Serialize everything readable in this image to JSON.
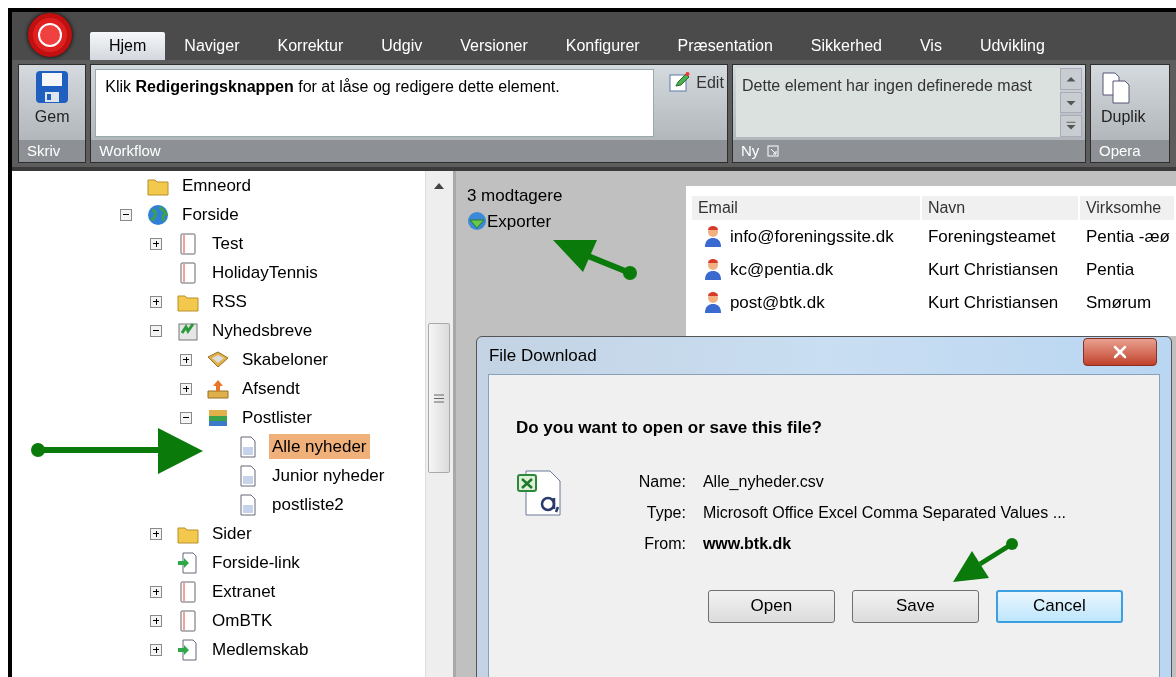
{
  "tabs": [
    {
      "label": "Hjem",
      "selected": true
    },
    {
      "label": "Naviger",
      "selected": false
    },
    {
      "label": "Korrektur",
      "selected": false
    },
    {
      "label": "Udgiv",
      "selected": false
    },
    {
      "label": "Versioner",
      "selected": false
    },
    {
      "label": "Konfigurer",
      "selected": false
    },
    {
      "label": "Præsentation",
      "selected": false
    },
    {
      "label": "Sikkerhed",
      "selected": false
    },
    {
      "label": "Vis",
      "selected": false
    },
    {
      "label": "Udvikling",
      "selected": false
    }
  ],
  "ribbon": {
    "write_group": {
      "label": "Skriv",
      "save_button": "Gem"
    },
    "workflow_group": {
      "label": "Workflow",
      "message": "Klik **Redigeringsknappen** for at låse og redigere dette element.",
      "edit_button": "Edit"
    },
    "new_group": {
      "label": "Ny",
      "text": "Dette element har ingen definerede mast"
    },
    "operations_group": {
      "label": "Opera",
      "duplicate_button": "Duplik"
    }
  },
  "tree": {
    "items": [
      {
        "label": "Emneord",
        "kind": "folder",
        "selected": false
      },
      {
        "label": "Forside",
        "kind": "globe",
        "selected": false,
        "expanded": true,
        "children": [
          {
            "label": "Test",
            "kind": "page",
            "selected": false,
            "expanded": false
          },
          {
            "label": "HolidayTennis",
            "kind": "page",
            "selected": false
          },
          {
            "label": "RSS",
            "kind": "folder",
            "selected": false,
            "expanded": false
          },
          {
            "label": "Nyhedsbreve",
            "kind": "newsletter",
            "selected": false,
            "expanded": true,
            "children": [
              {
                "label": "Skabeloner",
                "kind": "template",
                "selected": false,
                "expanded": false
              },
              {
                "label": "Afsendt",
                "kind": "outbox",
                "selected": false,
                "expanded": false
              },
              {
                "label": "Postlister",
                "kind": "stack",
                "selected": false,
                "expanded": true,
                "children": [
                  {
                    "label": "Alle nyheder",
                    "kind": "list",
                    "selected": true
                  },
                  {
                    "label": "Junior nyheder",
                    "kind": "list",
                    "selected": false
                  },
                  {
                    "label": "postliste2",
                    "kind": "list",
                    "selected": false
                  }
                ]
              }
            ]
          },
          {
            "label": "Sider",
            "kind": "folder",
            "selected": false,
            "expanded": false
          },
          {
            "label": "Forside-link",
            "kind": "link",
            "selected": false
          },
          {
            "label": "Extranet",
            "kind": "page",
            "selected": false,
            "expanded": false
          },
          {
            "label": "OmBTK",
            "kind": "page",
            "selected": false,
            "expanded": false
          },
          {
            "label": "Medlemskab",
            "kind": "link",
            "selected": false,
            "expanded": false
          }
        ]
      }
    ]
  },
  "recipients": {
    "count": "3 modtagere",
    "export_link": "Exporter",
    "table": {
      "columns": [
        "Email",
        "Navn",
        "Virksomhe"
      ],
      "rows": [
        [
          "info@foreningssite.dk",
          "Foreningsteamet",
          "Pentia -æø"
        ],
        [
          "kc@pentia.dk",
          "Kurt Christiansen",
          "Pentia"
        ],
        [
          "post@btk.dk",
          "Kurt Christiansen",
          "Smørum"
        ]
      ]
    }
  },
  "dialog": {
    "title": "File Download",
    "question": "Do you want to open or save this file?",
    "fields": [
      {
        "label": "Name:",
        "value": "Alle_nyheder.csv",
        "bold": false
      },
      {
        "label": "Type:",
        "value": "Microsoft Office Excel Comma Separated Values ...",
        "bold": false
      },
      {
        "label": "From:",
        "value": "www.btk.dk",
        "bold": true
      }
    ],
    "buttons": [
      {
        "label": "Open",
        "default": false
      },
      {
        "label": "Save",
        "default": false
      },
      {
        "label": "Cancel",
        "default": true
      }
    ]
  }
}
